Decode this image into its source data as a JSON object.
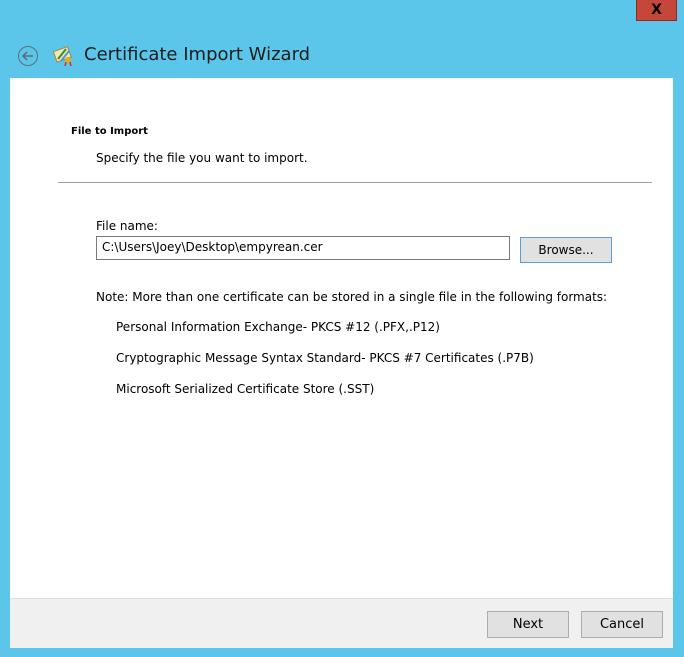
{
  "window": {
    "close_label": "X"
  },
  "header": {
    "title": "Certificate Import Wizard"
  },
  "page": {
    "heading": "File to Import",
    "subheading": "Specify the file you want to import."
  },
  "file": {
    "label": "File name:",
    "value": "C:\\Users\\Joey\\Desktop\\empyrean.cer",
    "browse_label": "Browse..."
  },
  "note": {
    "text": "Note:  More than one certificate can be stored in a single file in the following formats:",
    "formats": [
      "Personal Information Exchange- PKCS #12 (.PFX,.P12)",
      "Cryptographic Message Syntax Standard- PKCS #7 Certificates (.P7B)",
      "Microsoft Serialized Certificate Store (.SST)"
    ]
  },
  "footer": {
    "next_label": "Next",
    "cancel_label": "Cancel"
  },
  "colors": {
    "frame": "#5cc6ea",
    "close_button": "#c7463a",
    "footer": "#f0f0f0"
  },
  "icons": {
    "back": "back-arrow-icon",
    "wizard": "certificate-icon",
    "close": "close-icon"
  }
}
